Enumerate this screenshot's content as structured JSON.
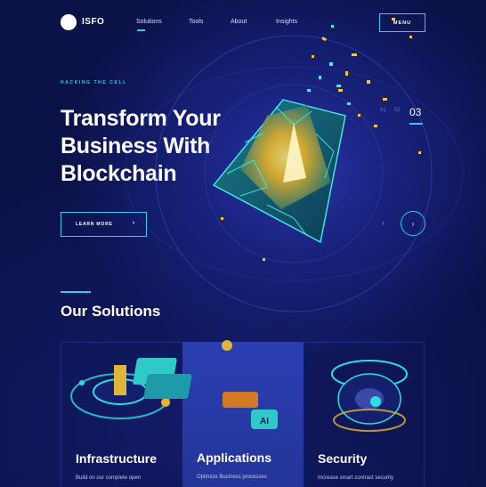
{
  "brand": {
    "name": "ISFO"
  },
  "nav": {
    "links": [
      "Solutions",
      "Tools",
      "About",
      "Insights"
    ],
    "menu_label": "MENU"
  },
  "hero": {
    "eyebrow": "HACKING THE CELL",
    "title": "Transform Your Business With Blockchain",
    "cta_label": "LEARN MORE",
    "cta_arrow": "›"
  },
  "pager": {
    "items": [
      "01",
      "02",
      "03"
    ],
    "active": "03",
    "prev_arrow": "‹",
    "next_arrow": "›"
  },
  "solutions": {
    "title": "Our Solutions",
    "cards": [
      {
        "title": "Infrastructure",
        "desc": "Build on our complete open",
        "icon": "ring-platform-icon"
      },
      {
        "title": "Applications",
        "desc": "Optimize Business processes",
        "icon": "ai-chip-stack-icon"
      },
      {
        "title": "Security",
        "desc": "Increase smart contract security",
        "icon": "shield-disc-icon"
      }
    ]
  },
  "colors": {
    "accent": "#37c9f0",
    "background": "#0d1552",
    "card_highlight": "#2b3fb3"
  }
}
